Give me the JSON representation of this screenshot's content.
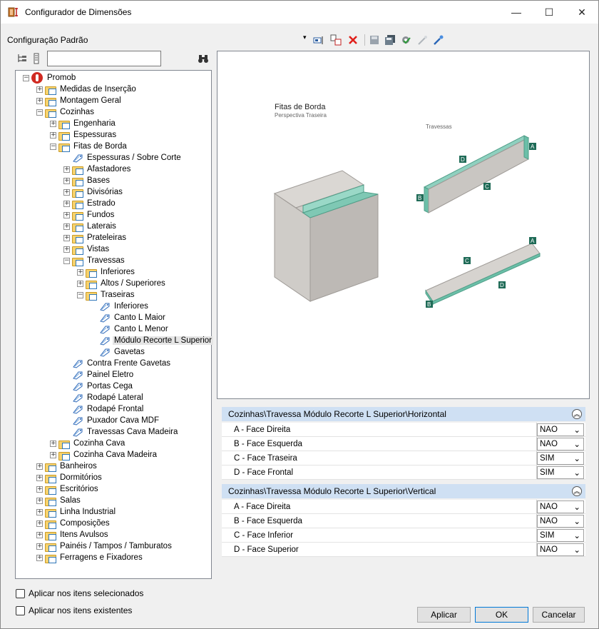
{
  "window": {
    "title": "Configurador de Dimensões",
    "minimize": "—",
    "maximize": "☐",
    "close": "✕"
  },
  "toolbar": {
    "config_label": "Configuração Padrão",
    "dropdown": "▾"
  },
  "search": {
    "value": ""
  },
  "tree": {
    "root": "Promob",
    "items": [
      {
        "label": "Medidas de Inserção",
        "level": 1,
        "type": "folder",
        "exp": "+"
      },
      {
        "label": "Montagem Geral",
        "level": 1,
        "type": "folder",
        "exp": "+"
      },
      {
        "label": "Cozinhas",
        "level": 1,
        "type": "folder",
        "exp": "−"
      },
      {
        "label": "Engenharia",
        "level": 2,
        "type": "folder",
        "exp": "+"
      },
      {
        "label": "Espessuras",
        "level": 2,
        "type": "folder",
        "exp": "+"
      },
      {
        "label": "Fitas de Borda",
        "level": 2,
        "type": "folder",
        "exp": "−"
      },
      {
        "label": "Espessuras / Sobre Corte",
        "level": 3,
        "type": "tag",
        "exp": ""
      },
      {
        "label": "Afastadores",
        "level": 3,
        "type": "folder",
        "exp": "+"
      },
      {
        "label": "Bases",
        "level": 3,
        "type": "folder",
        "exp": "+"
      },
      {
        "label": "Divisórias",
        "level": 3,
        "type": "folder",
        "exp": "+"
      },
      {
        "label": "Estrado",
        "level": 3,
        "type": "folder",
        "exp": "+"
      },
      {
        "label": "Fundos",
        "level": 3,
        "type": "folder",
        "exp": "+"
      },
      {
        "label": "Laterais",
        "level": 3,
        "type": "folder",
        "exp": "+"
      },
      {
        "label": "Prateleiras",
        "level": 3,
        "type": "folder",
        "exp": "+"
      },
      {
        "label": "Vistas",
        "level": 3,
        "type": "folder",
        "exp": "+"
      },
      {
        "label": "Travessas",
        "level": 3,
        "type": "folder",
        "exp": "−"
      },
      {
        "label": "Inferiores",
        "level": 4,
        "type": "folder",
        "exp": "+"
      },
      {
        "label": "Altos / Superiores",
        "level": 4,
        "type": "folder",
        "exp": "+"
      },
      {
        "label": "Traseiras",
        "level": 4,
        "type": "folder",
        "exp": "−"
      },
      {
        "label": "Inferiores",
        "level": 5,
        "type": "tag",
        "exp": ""
      },
      {
        "label": "Canto L Maior",
        "level": 5,
        "type": "tag",
        "exp": ""
      },
      {
        "label": "Canto L Menor",
        "level": 5,
        "type": "tag",
        "exp": ""
      },
      {
        "label": "Módulo Recorte L Superior",
        "level": 5,
        "type": "tag",
        "exp": "",
        "selected": true
      },
      {
        "label": "Gavetas",
        "level": 5,
        "type": "tag",
        "exp": ""
      },
      {
        "label": "Contra Frente Gavetas",
        "level": 3,
        "type": "tag",
        "exp": ""
      },
      {
        "label": "Painel Eletro",
        "level": 3,
        "type": "tag",
        "exp": ""
      },
      {
        "label": "Portas Cega",
        "level": 3,
        "type": "tag",
        "exp": ""
      },
      {
        "label": "Rodapé Lateral",
        "level": 3,
        "type": "tag",
        "exp": ""
      },
      {
        "label": "Rodapé Frontal",
        "level": 3,
        "type": "tag",
        "exp": ""
      },
      {
        "label": "Puxador Cava MDF",
        "level": 3,
        "type": "tag",
        "exp": ""
      },
      {
        "label": "Travessas Cava Madeira",
        "level": 3,
        "type": "tag",
        "exp": ""
      },
      {
        "label": "Cozinha Cava",
        "level": 2,
        "type": "folder",
        "exp": "+"
      },
      {
        "label": "Cozinha Cava Madeira",
        "level": 2,
        "type": "folder",
        "exp": "+"
      },
      {
        "label": "Banheiros",
        "level": 1,
        "type": "folder",
        "exp": "+"
      },
      {
        "label": "Dormitórios",
        "level": 1,
        "type": "folder",
        "exp": "+"
      },
      {
        "label": "Escritórios",
        "level": 1,
        "type": "folder",
        "exp": "+"
      },
      {
        "label": "Salas",
        "level": 1,
        "type": "folder",
        "exp": "+"
      },
      {
        "label": "Linha Industrial",
        "level": 1,
        "type": "folder",
        "exp": "+"
      },
      {
        "label": "Composições",
        "level": 1,
        "type": "folder",
        "exp": "+"
      },
      {
        "label": "Itens Avulsos",
        "level": 1,
        "type": "folder",
        "exp": "+"
      },
      {
        "label": "Painéis / Tampos / Tamburatos",
        "level": 1,
        "type": "folder",
        "exp": "+"
      },
      {
        "label": "Ferragens e Fixadores",
        "level": 1,
        "type": "folder",
        "exp": "+"
      }
    ]
  },
  "options": {
    "apply_selected": "Aplicar nos itens selecionados",
    "apply_existing": "Aplicar nos itens existentes"
  },
  "preview": {
    "title": "Fitas de Borda",
    "subtitle": "Perspectiva Traseira",
    "travessas_label": "Travessas",
    "letters": {
      "a": "A",
      "b": "B",
      "c": "C",
      "d": "D"
    }
  },
  "groups": [
    {
      "header": "Cozinhas\\Travessa Módulo Recorte L Superior\\Horizontal",
      "rows": [
        {
          "name": "A - Face Direita",
          "value": "NAO"
        },
        {
          "name": "B - Face Esquerda",
          "value": "NAO"
        },
        {
          "name": "C - Face Traseira",
          "value": "SIM"
        },
        {
          "name": "D - Face Frontal",
          "value": "SIM"
        }
      ]
    },
    {
      "header": "Cozinhas\\Travessa Módulo Recorte L Superior\\Vertical",
      "rows": [
        {
          "name": "A - Face Direita",
          "value": "NAO"
        },
        {
          "name": "B - Face Esquerda",
          "value": "NAO"
        },
        {
          "name": "C - Face Inferior",
          "value": "SIM"
        },
        {
          "name": "D - Face Superior",
          "value": "NAO"
        }
      ]
    }
  ],
  "buttons": {
    "apply": "Aplicar",
    "ok": "OK",
    "cancel": "Cancelar"
  },
  "colors": {
    "accent": "#0078d7",
    "group_header": "#cfe0f3",
    "edge_band": "#6bbfa8",
    "letter_tag": "#1f6b57"
  }
}
